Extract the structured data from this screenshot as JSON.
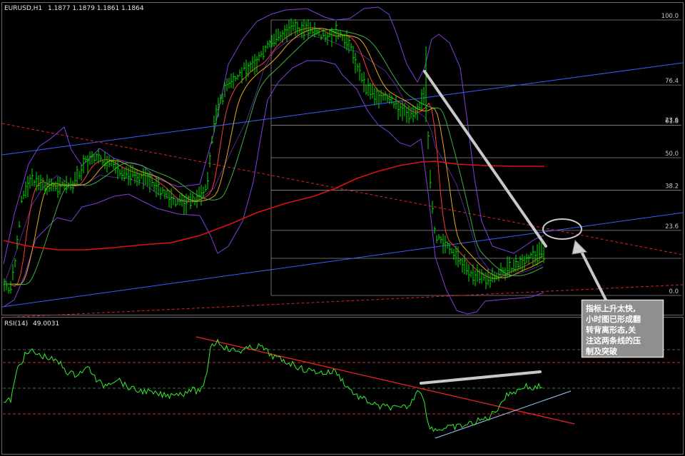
{
  "main_header": {
    "symbol": "EURUSD,H1",
    "ohlc": "1.1877 1.1879 1.1861 1.1864"
  },
  "rsi_header": {
    "label": "RSI(14)",
    "value": "49.0031"
  },
  "annotation": {
    "lines": [
      "指标上升太快,",
      "小时图已形成翻",
      "转背离形态,关",
      "注这两条线的压",
      "制及突破"
    ]
  },
  "colors": {
    "background": "#000000",
    "bull_candle": "#00dd00",
    "fib_levels": "#8a8a8a",
    "trendline_blue": "#3a5cff",
    "trendline_red_dashed": "#dd2222",
    "ma_red": "#dd1111",
    "bollinger": "#7f3fdf",
    "rsi_line": "#33ee33",
    "rsi_red_line": "#ee2222",
    "rsi_support": "#9ecbff",
    "markup_white": "#c8c8c8"
  },
  "chart_data": [
    {
      "type": "candlestick",
      "title": "EURUSD,H1",
      "indicators": [
        "Bollinger Bands",
        "moving averages",
        "Fibonacci retracement",
        "trendlines"
      ],
      "fibonacci_levels": [
        {
          "label": "100.0",
          "level": 1.0
        },
        {
          "label": "76.4",
          "level": 0.764
        },
        {
          "label": "61.8",
          "level": 0.618
        },
        {
          "label": "50.0",
          "level": 0.5
        },
        {
          "label": "38.2",
          "level": 0.382
        },
        {
          "label": "23.6",
          "level": 0.236
        },
        {
          "label": "0.0",
          "level": 0.0
        }
      ],
      "extra_level_label": "23.6",
      "grid": false
    },
    {
      "type": "line",
      "title": "RSI(14)",
      "last_value": 49.0031,
      "ylim": [
        0,
        100
      ],
      "dashed_levels": [
        {
          "value": 80,
          "color": "#555555"
        },
        {
          "value": 70,
          "color": "#dd2222"
        },
        {
          "value": 50,
          "color": "#2e7d2e"
        },
        {
          "value": 30,
          "color": "#dd2222"
        }
      ]
    }
  ]
}
